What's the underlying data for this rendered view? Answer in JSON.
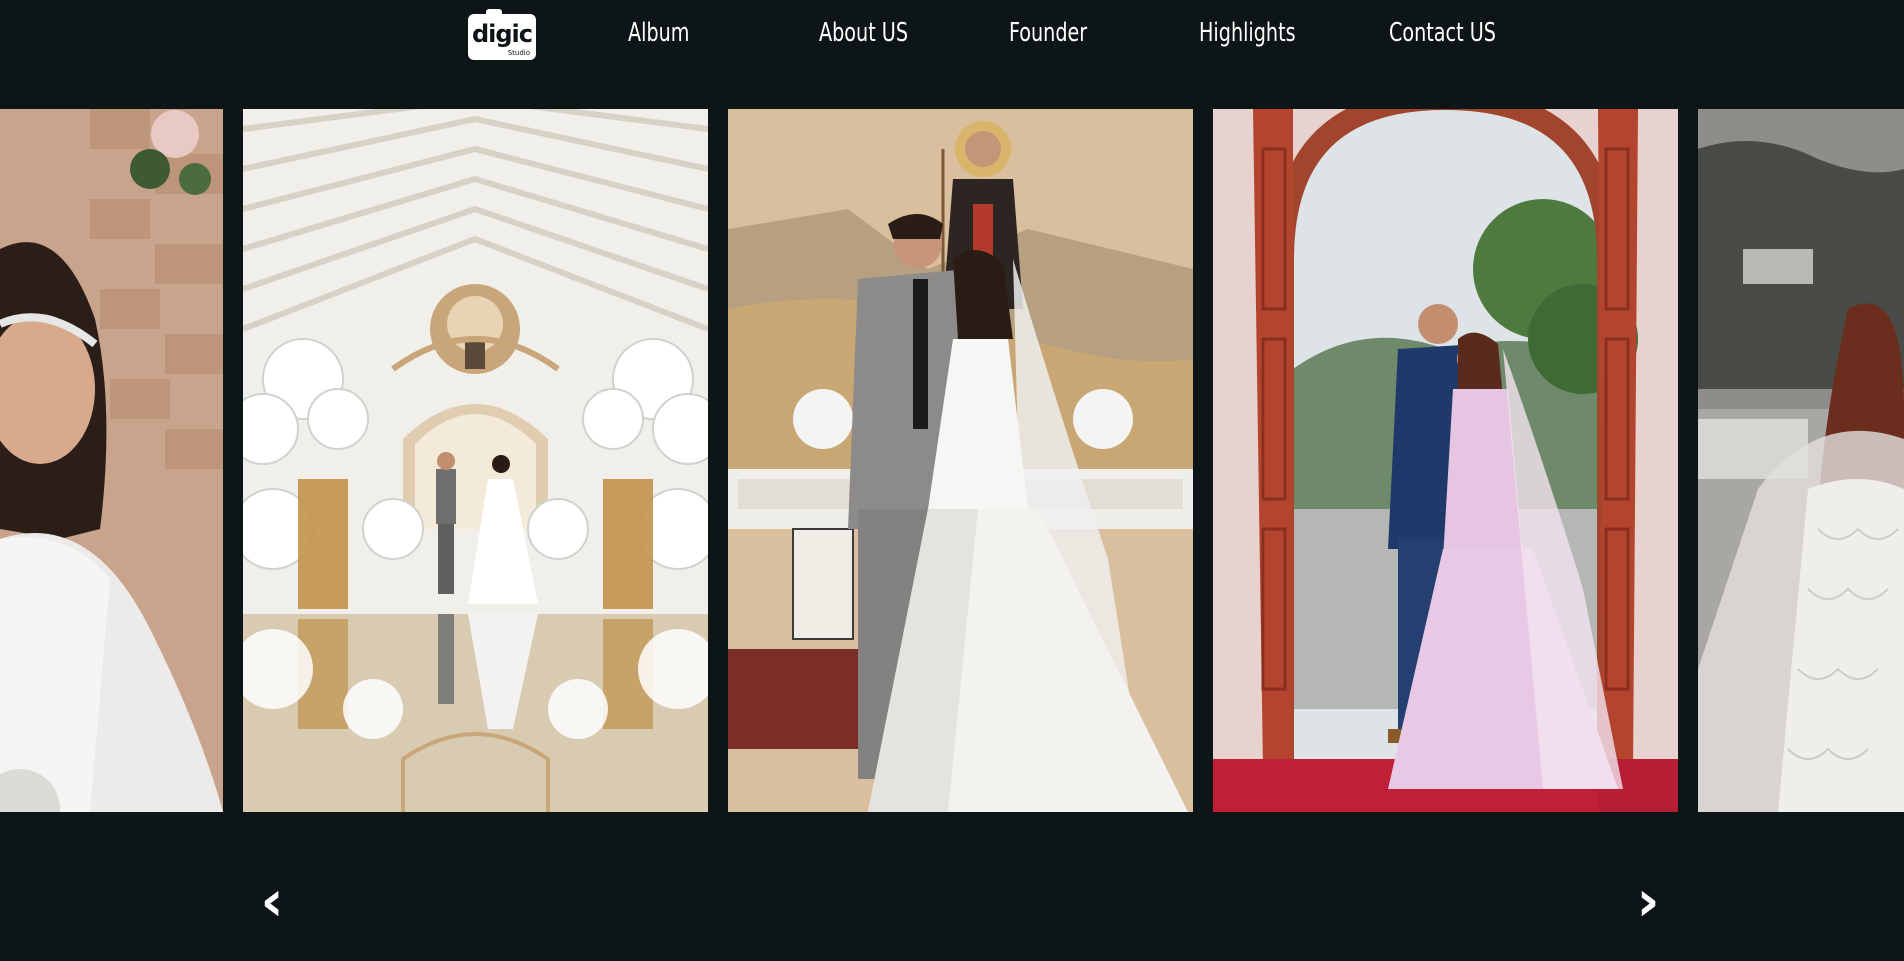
{
  "brand": {
    "logo_main": "digic",
    "logo_sub": "Studio"
  },
  "nav": {
    "items": [
      {
        "label": "Album"
      },
      {
        "label": "About US"
      },
      {
        "label": "Founder"
      },
      {
        "label": "Highlights"
      },
      {
        "label": "Contact US"
      }
    ]
  },
  "carousel": {
    "slides": [
      {
        "subject": "bride portrait with tiara in front of stone wall and flowers"
      },
      {
        "subject": "couple at altar in white church with floral decor and mirrored floor"
      },
      {
        "subject": "groom kissing bride's forehead before church altar with saint painting"
      },
      {
        "subject": "groom kissing bride in red wooden church doorway"
      },
      {
        "subject": "bride in lace gown outdoors near mountains"
      }
    ],
    "prev_icon": "chevron-left-icon",
    "next_icon": "chevron-right-icon",
    "prev_glyph": "‹",
    "next_glyph": "›"
  },
  "colors": {
    "background": "#0d1517",
    "text": "#ffffff"
  }
}
